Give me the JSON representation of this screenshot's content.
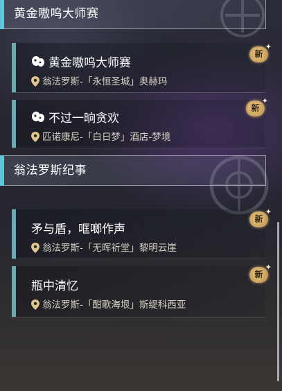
{
  "groups": [
    {
      "title": "黄金嗷呜大师赛",
      "quests": [
        {
          "title": "黄金嗷呜大师赛",
          "has_icon": true,
          "location": "翁法罗斯-「永恒圣城」奥赫玛",
          "badge": "新"
        },
        {
          "title": "不过一晌贪欢",
          "has_icon": true,
          "location": "匹诺康尼-「白日梦」酒店-梦境",
          "badge": "新"
        }
      ]
    },
    {
      "title": "翁法罗斯纪事",
      "quests": [
        {
          "title": "矛与盾，哐啷作声",
          "has_icon": false,
          "location": "翁法罗斯-「无晖祈堂」黎明云崖",
          "badge": "新"
        },
        {
          "title": "瓶中清忆",
          "has_icon": false,
          "location": "翁法罗斯-「酣歌海垠」斯缇科西亚",
          "badge": "新"
        }
      ]
    }
  ],
  "icons": {
    "quest_type": "paw-mission-icon",
    "location": "map-pin-icon",
    "new_badge": "new-badge-icon"
  },
  "colors": {
    "header_accent": "#5fc8d8",
    "quest_accent": "#6aaab3",
    "badge_gold": "#d9b26b"
  }
}
